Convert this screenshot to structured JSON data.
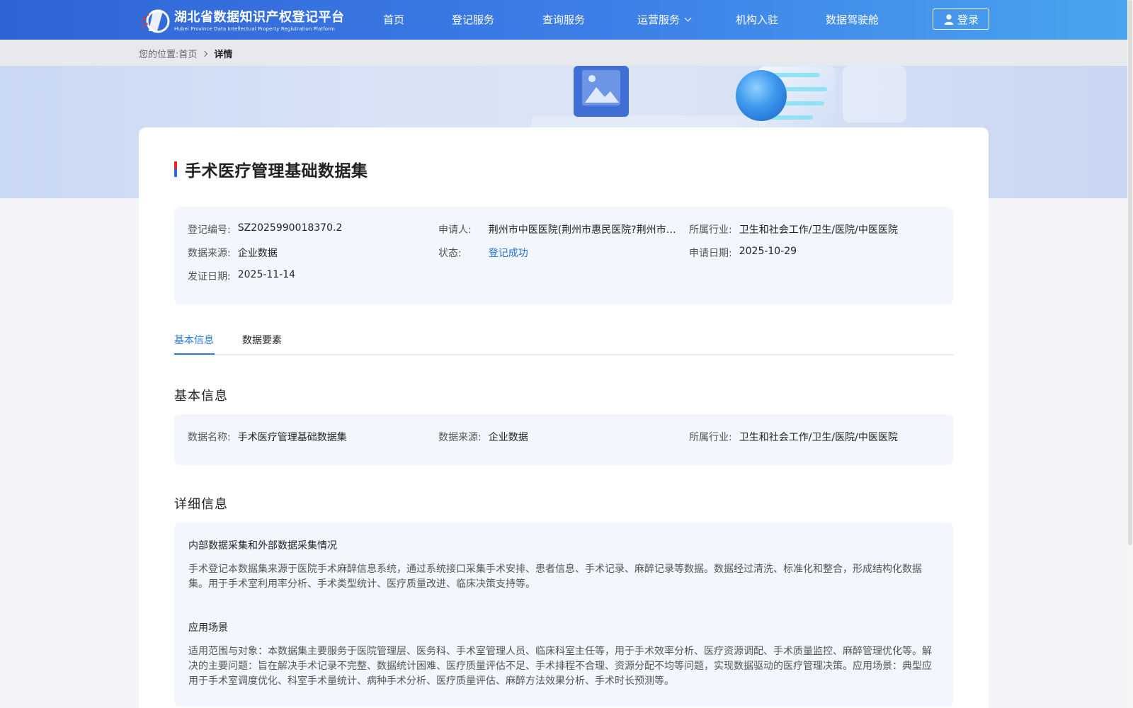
{
  "header": {
    "logo_cn": "湖北省数据知识产权登记平台",
    "logo_en": "Hubei Province Data Intellectual Property Registration Platform",
    "nav": [
      "首页",
      "登记服务",
      "查询服务",
      "运营服务",
      "机构入驻",
      "数据驾驶舱"
    ],
    "login_label": "登录"
  },
  "breadcrumb": {
    "prefix": "您的位置:",
    "home": "首页",
    "current": "详情"
  },
  "record": {
    "title": "手术医疗管理基础数据集",
    "fields": {
      "reg_no_label": "登记编号:",
      "reg_no": "SZ2025990018370.2",
      "applicant_label": "申请人:",
      "applicant": "荆州市中医医院(荆州市惠民医院?荆州市…",
      "industry_label": "所属行业:",
      "industry": "卫生和社会工作/卫生/医院/中医医院",
      "source_label": "数据来源:",
      "source": "企业数据",
      "status_label": "状态:",
      "status": "登记成功",
      "apply_date_label": "申请日期:",
      "apply_date": "2025-10-29",
      "issue_date_label": "发证日期:",
      "issue_date": "2025-11-14"
    }
  },
  "tabs": [
    "基本信息",
    "数据要素"
  ],
  "basic": {
    "section_title": "基本信息",
    "name_label": "数据名称:",
    "name": "手术医疗管理基础数据集",
    "source_label": "数据来源:",
    "source": "企业数据",
    "industry_label": "所属行业:",
    "industry": "卫生和社会工作/卫生/医院/中医医院"
  },
  "detail": {
    "section_title": "详细信息",
    "collection_head": "内部数据采集和外部数据采集情况",
    "collection_text": "手术登记本数据集来源于医院手术麻醉信息系统，通过系统接口采集手术安排、患者信息、手术记录、麻醉记录等数据。数据经过清洗、标准化和整合，形成结构化数据集。用于手术室利用率分析、手术类型统计、医疗质量改进、临床决策支持等。",
    "scenario_head": "应用场景",
    "scenario_text": "适用范围与对象：本数据集主要服务于医院管理层、医务科、手术室管理人员、临床科室主任等，用于手术效率分析、医疗资源调配、手术质量监控、麻醉管理优化等。解决的主要问题：旨在解决手术记录不完整、数据统计困难、医疗质量评估不足、手术排程不合理、资源分配不均等问题，实现数据驱动的医疗管理决策。应用场景：典型应用于手术室调度优化、科室手术量统计、病种手术分析、医疗质量评估、麻醉方法效果分析、手术时长预测等。"
  }
}
